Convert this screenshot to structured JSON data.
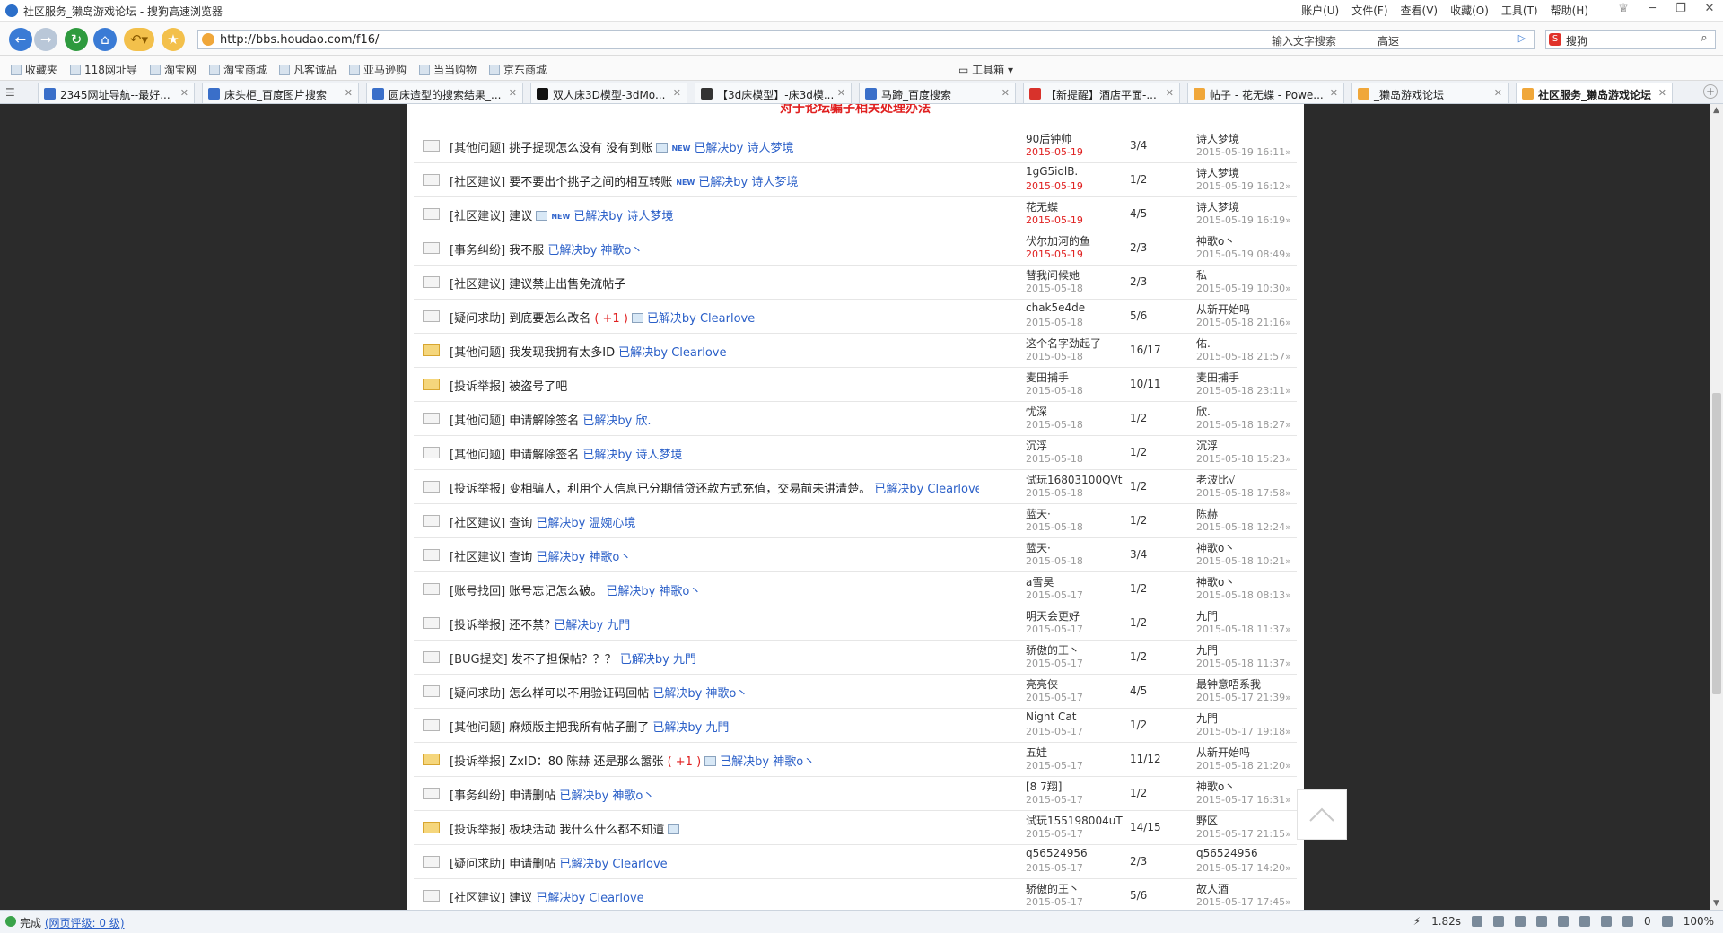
{
  "window": {
    "title": "社区服务_獭岛游戏论坛 - 搜狗高速浏览器",
    "menus": [
      "账户(U)",
      "文件(F)",
      "查看(V)",
      "收藏(O)",
      "工具(T)",
      "帮助(H)"
    ]
  },
  "nav": {
    "url": "http://bbs.houdao.com/f16/",
    "hint": "输入文字搜索",
    "speed_label": "高速",
    "search_placeholder": "搜狗"
  },
  "bookmarks": {
    "items": [
      "收藏夹",
      "118网址导",
      "淘宝网",
      "淘宝商城",
      "凡客诚品",
      "亚马逊购",
      "当当购物",
      "京东商城"
    ],
    "toolbox": "工具箱"
  },
  "tabs": [
    {
      "label": "2345网址导航--最好..."
    },
    {
      "label": "床头柜_百度图片搜索"
    },
    {
      "label": "圆床造型的搜索结果_..."
    },
    {
      "label": "双人床3D模型-3dMo..."
    },
    {
      "label": "【3d床模型】-床3d模..."
    },
    {
      "label": "马蹄_百度搜索"
    },
    {
      "label": "【新提醒】酒店平面-..."
    },
    {
      "label": "帖子 - 花无蝶 - Powe..."
    },
    {
      "label": "_獭岛游戏论坛"
    },
    {
      "label": "社区服务_獭岛游戏论坛"
    }
  ],
  "notice": "对于论坛骗子相关处理办法",
  "threads": [
    {
      "category": "[其他问题]",
      "title": "挑子提现怎么没有  没有到账",
      "plus": "",
      "img": true,
      "new": true,
      "solved": "已解决by 诗人梦境",
      "author": "90后钟帅",
      "date": "2015-05-19",
      "date_red": true,
      "stat": "3/4",
      "last_user": "诗人梦境",
      "last_time": "2015-05-19 16:11»",
      "hot": false
    },
    {
      "category": "[社区建议]",
      "title": "要不要出个挑子之间的相互转账",
      "plus": "",
      "img": false,
      "new": true,
      "solved": "已解决by 诗人梦境",
      "author": "1gG5iolB.",
      "date": "2015-05-19",
      "date_red": true,
      "stat": "1/2",
      "last_user": "诗人梦境",
      "last_time": "2015-05-19 16:12»",
      "hot": false
    },
    {
      "category": "[社区建议]",
      "title": "建议",
      "plus": "",
      "img": true,
      "new": true,
      "solved": "已解决by 诗人梦境",
      "author": "花无蝶",
      "date": "2015-05-19",
      "date_red": true,
      "stat": "4/5",
      "last_user": "诗人梦境",
      "last_time": "2015-05-19 16:19»",
      "hot": false
    },
    {
      "category": "[事务纠纷]",
      "title": "我不服",
      "plus": "",
      "img": false,
      "new": false,
      "solved": "已解决by 神歌o丶",
      "author": "伏尔加河的鱼",
      "date": "2015-05-19",
      "date_red": true,
      "stat": "2/3",
      "last_user": "神歌o丶",
      "last_time": "2015-05-19 08:49»",
      "hot": false
    },
    {
      "category": "[社区建议]",
      "title": "建议禁止出售免流帖子",
      "plus": "",
      "img": false,
      "new": false,
      "solved": "",
      "author": "替我问候她",
      "date": "2015-05-18",
      "date_red": false,
      "stat": "2/3",
      "last_user": "私",
      "last_time": "2015-05-19 10:30»",
      "hot": false
    },
    {
      "category": "[疑问求助]",
      "title": "到底要怎么改名",
      "plus": "( +1 )",
      "img": true,
      "new": false,
      "solved": "已解决by Clearlove",
      "author": "chak5e4de",
      "date": "2015-05-18",
      "date_red": false,
      "stat": "5/6",
      "last_user": "从新开始吗",
      "last_time": "2015-05-18 21:16»",
      "hot": false
    },
    {
      "category": "[其他问题]",
      "title": "我发现我拥有太多ID",
      "plus": "",
      "img": false,
      "new": false,
      "solved": "已解决by Clearlove",
      "author": "这个名字劲起了",
      "date": "2015-05-18",
      "date_red": false,
      "stat": "16/17",
      "last_user": "佑.",
      "last_time": "2015-05-18 21:57»",
      "hot": true
    },
    {
      "category": "[投诉举报]",
      "title": "被盗号了吧",
      "plus": "",
      "img": false,
      "new": false,
      "solved": "",
      "author": "麦田捕手",
      "date": "2015-05-18",
      "date_red": false,
      "stat": "10/11",
      "last_user": "麦田捕手",
      "last_time": "2015-05-18 23:11»",
      "hot": true
    },
    {
      "category": "[其他问题]",
      "title": "申请解除签名",
      "plus": "",
      "img": false,
      "new": false,
      "solved": "已解决by 欣.",
      "author": "忧深",
      "date": "2015-05-18",
      "date_red": false,
      "stat": "1/2",
      "last_user": "欣.",
      "last_time": "2015-05-18 18:27»",
      "hot": false
    },
    {
      "category": "[其他问题]",
      "title": "申请解除签名",
      "plus": "",
      "img": false,
      "new": false,
      "solved": "已解决by 诗人梦境",
      "author": "沉浮",
      "date": "2015-05-18",
      "date_red": false,
      "stat": "1/2",
      "last_user": "沉浮",
      "last_time": "2015-05-18 15:23»",
      "hot": false
    },
    {
      "category": "[投诉举报]",
      "title": "变相骗人，利用个人信息已分期借贷还款方式充值，交易前未讲清楚。",
      "plus": "",
      "img": false,
      "new": false,
      "solved": "已解决by Clearlove",
      "author": "试玩16803100QVt",
      "date": "2015-05-18",
      "date_red": false,
      "stat": "1/2",
      "last_user": "老波比√",
      "last_time": "2015-05-18 17:58»",
      "hot": false
    },
    {
      "category": "[社区建议]",
      "title": "查询",
      "plus": "",
      "img": false,
      "new": false,
      "solved": "已解决by 温婉心境",
      "author": "蓝天·",
      "date": "2015-05-18",
      "date_red": false,
      "stat": "1/2",
      "last_user": "陈赫",
      "last_time": "2015-05-18 12:24»",
      "hot": false
    },
    {
      "category": "[社区建议]",
      "title": "查询",
      "plus": "",
      "img": false,
      "new": false,
      "solved": "已解决by 神歌o丶",
      "author": "蓝天·",
      "date": "2015-05-18",
      "date_red": false,
      "stat": "3/4",
      "last_user": "神歌o丶",
      "last_time": "2015-05-18 10:21»",
      "hot": false
    },
    {
      "category": "[账号找回]",
      "title": "账号忘记怎么破。",
      "plus": "",
      "img": false,
      "new": false,
      "solved": "已解决by 神歌o丶",
      "author": "a雪昊",
      "date": "2015-05-17",
      "date_red": false,
      "stat": "1/2",
      "last_user": "神歌o丶",
      "last_time": "2015-05-18 08:13»",
      "hot": false
    },
    {
      "category": "[投诉举报]",
      "title": "还不禁?",
      "plus": "",
      "img": false,
      "new": false,
      "solved": "已解决by 九門",
      "author": "明天会更好",
      "date": "2015-05-17",
      "date_red": false,
      "stat": "1/2",
      "last_user": "九門",
      "last_time": "2015-05-18 11:37»",
      "hot": false
    },
    {
      "category": "[BUG提交]",
      "title": "发不了担保帖？？？",
      "plus": "",
      "img": false,
      "new": false,
      "solved": "已解决by 九門",
      "author": "骄傲的王丶",
      "date": "2015-05-17",
      "date_red": false,
      "stat": "1/2",
      "last_user": "九門",
      "last_time": "2015-05-18 11:37»",
      "hot": false
    },
    {
      "category": "[疑问求助]",
      "title": "怎么样可以不用验证码回帖",
      "plus": "",
      "img": false,
      "new": false,
      "solved": "已解决by 神歌o丶",
      "author": "亮亮侠",
      "date": "2015-05-17",
      "date_red": false,
      "stat": "4/5",
      "last_user": "最钟意唔系我",
      "last_time": "2015-05-17 21:39»",
      "hot": false
    },
    {
      "category": "[其他问题]",
      "title": "麻烦版主把我所有帖子删了",
      "plus": "",
      "img": false,
      "new": false,
      "solved": "已解决by 九門",
      "author": "Night  Cat",
      "date": "2015-05-17",
      "date_red": false,
      "stat": "1/2",
      "last_user": "九門",
      "last_time": "2015-05-17 19:18»",
      "hot": false
    },
    {
      "category": "[投诉举报]",
      "title": "ZxID：80 陈赫 还是那么嚣张",
      "plus": "( +1 )",
      "img": true,
      "new": false,
      "solved": "已解决by 神歌o丶",
      "author": "五娃",
      "date": "2015-05-17",
      "date_red": false,
      "stat": "11/12",
      "last_user": "从新开始吗",
      "last_time": "2015-05-18 21:20»",
      "hot": true
    },
    {
      "category": "[事务纠纷]",
      "title": "申请删帖",
      "plus": "",
      "img": false,
      "new": false,
      "solved": "已解决by 神歌o丶",
      "author": "[8 7翔]",
      "date": "2015-05-17",
      "date_red": false,
      "stat": "1/2",
      "last_user": "神歌o丶",
      "last_time": "2015-05-17 16:31»",
      "hot": false
    },
    {
      "category": "[投诉举报]",
      "title": "板块活动 我什么什么都不知道",
      "plus": "",
      "img": true,
      "new": false,
      "solved": "",
      "author": "试玩155198004uT",
      "date": "2015-05-17",
      "date_red": false,
      "stat": "14/15",
      "last_user": "野区",
      "last_time": "2015-05-17 21:15»",
      "hot": true
    },
    {
      "category": "[疑问求助]",
      "title": "申请删帖",
      "plus": "",
      "img": false,
      "new": false,
      "solved": "已解决by Clearlove",
      "author": "q56524956",
      "date": "2015-05-17",
      "date_red": false,
      "stat": "2/3",
      "last_user": "q56524956",
      "last_time": "2015-05-17 14:20»",
      "hot": false
    },
    {
      "category": "[社区建议]",
      "title": "建议",
      "plus": "",
      "img": false,
      "new": false,
      "solved": "已解决by Clearlove",
      "author": "骄傲的王丶",
      "date": "2015-05-17",
      "date_red": false,
      "stat": "5/6",
      "last_user": "故人酒",
      "last_time": "2015-05-17 17:45»",
      "hot": false
    }
  ],
  "status": {
    "done": "完成",
    "rating": "(网页评级: 0 级)",
    "load_time": "1.82s",
    "count": "0",
    "zoom": "100%"
  }
}
